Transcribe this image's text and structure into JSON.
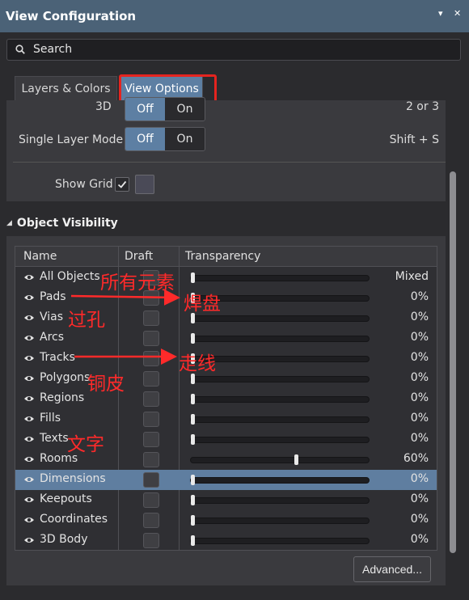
{
  "window": {
    "title": "View Configuration",
    "ctrl_menu": "▾",
    "ctrl_close": "✕"
  },
  "search": {
    "placeholder": "Search"
  },
  "tabs": [
    {
      "label": "Layers & Colors"
    },
    {
      "label": "View Options"
    }
  ],
  "view_options": {
    "mode_3d": {
      "label": "3D",
      "off": "Off",
      "on": "On",
      "selected": "Off",
      "shortcut": "2 or 3"
    },
    "single_layer_mode": {
      "label": "Single Layer Mode",
      "off": "Off",
      "on": "On",
      "selected": "Off",
      "shortcut": "Shift + S"
    },
    "show_grid": {
      "label": "Show Grid",
      "checked": true,
      "color": "#4a4a57"
    }
  },
  "object_visibility": {
    "title": "Object Visibility",
    "columns": [
      "Name",
      "Draft",
      "Transparency"
    ],
    "rows": [
      {
        "name": "All Objects",
        "transparency": "Mixed",
        "level": 0.0
      },
      {
        "name": "Pads",
        "transparency": "0%",
        "level": 0.0
      },
      {
        "name": "Vias",
        "transparency": "0%",
        "level": 0.0
      },
      {
        "name": "Arcs",
        "transparency": "0%",
        "level": 0.0
      },
      {
        "name": "Tracks",
        "transparency": "0%",
        "level": 0.0
      },
      {
        "name": "Polygons",
        "transparency": "0%",
        "level": 0.0
      },
      {
        "name": "Regions",
        "transparency": "0%",
        "level": 0.0
      },
      {
        "name": "Fills",
        "transparency": "0%",
        "level": 0.0
      },
      {
        "name": "Texts",
        "transparency": "0%",
        "level": 0.0
      },
      {
        "name": "Rooms",
        "transparency": "60%",
        "level": 0.6
      },
      {
        "name": "Dimensions",
        "transparency": "0%",
        "level": 0.0,
        "selected": true
      },
      {
        "name": "Keepouts",
        "transparency": "0%",
        "level": 0.0
      },
      {
        "name": "Coordinates",
        "transparency": "0%",
        "level": 0.0
      },
      {
        "name": "3D Body",
        "transparency": "0%",
        "level": 0.0
      }
    ],
    "advanced_button": "Advanced..."
  },
  "annotations": {
    "all_objects": "所有元素",
    "pads": "焊盘",
    "vias": "过孔",
    "tracks": "走线",
    "polygons": "铜皮",
    "texts": "文字",
    "color": "#ff2a2a"
  },
  "colors": {
    "titlebar": "#4b6277",
    "accent": "#5d7fa3",
    "highlight": "#e5241f",
    "selected_row": "#5f7ea0"
  }
}
